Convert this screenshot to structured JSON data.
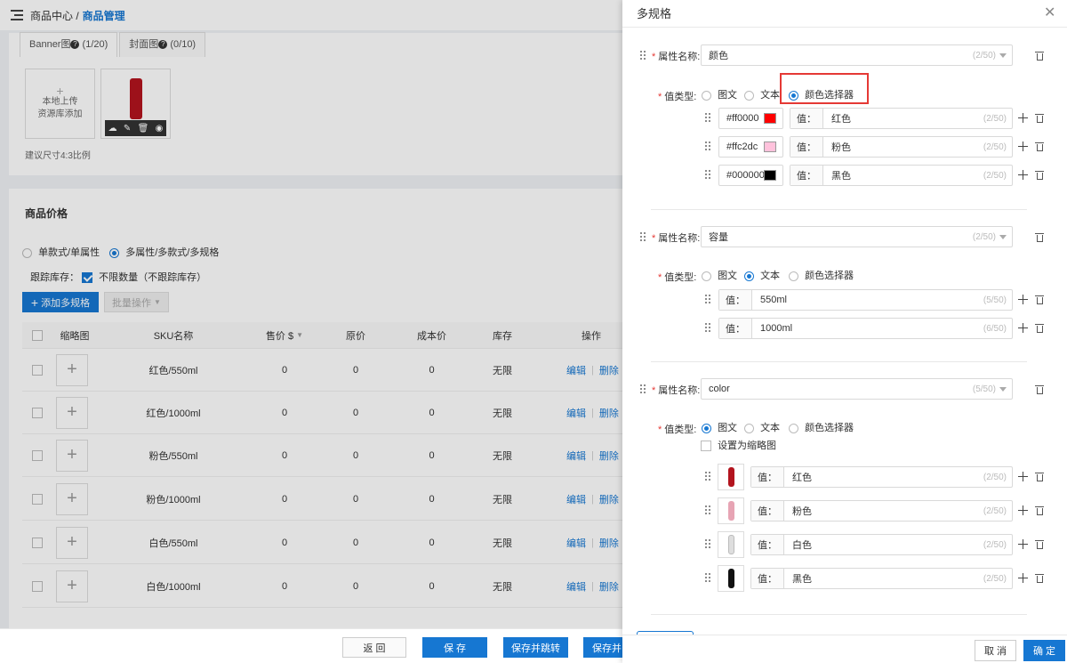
{
  "page": {
    "breadcrumb_root": "商品中心 /",
    "breadcrumb_current": "商品管理",
    "tabs": [
      {
        "label": "Banner图",
        "count": "(1/20)"
      },
      {
        "label": "封面图",
        "count": "(0/10)"
      }
    ],
    "upload_line1": "本地上传",
    "upload_line2": "资源库添加",
    "size_hint": "建议尺寸4:3比例",
    "price_section_title": "商品价格",
    "mode_single": "单款式/单属性",
    "mode_multi": "多属性/多款式/多规格",
    "stock_label": "跟踪库存：",
    "stock_unlimited": "不限数量（不跟踪库存）",
    "add_spec_button": "添加多规格",
    "batch_button": "批量操作",
    "table": {
      "headers": [
        "缩略图",
        "SKU名称",
        "售价 $",
        "原价",
        "成本价",
        "库存",
        "操作"
      ],
      "rows": [
        {
          "name": "红色/550ml",
          "price": "0",
          "orig": "0",
          "cost": "0",
          "stock": "无限"
        },
        {
          "name": "红色/1000ml",
          "price": "0",
          "orig": "0",
          "cost": "0",
          "stock": "无限"
        },
        {
          "name": "粉色/550ml",
          "price": "0",
          "orig": "0",
          "cost": "0",
          "stock": "无限"
        },
        {
          "name": "粉色/1000ml",
          "price": "0",
          "orig": "0",
          "cost": "0",
          "stock": "无限"
        },
        {
          "name": "白色/550ml",
          "price": "0",
          "orig": "0",
          "cost": "0",
          "stock": "无限"
        },
        {
          "name": "白色/1000ml",
          "price": "0",
          "orig": "0",
          "cost": "0",
          "stock": "无限"
        }
      ],
      "edit_label": "编辑",
      "delete_label": "删除",
      "sep": "|"
    },
    "footer_buttons": {
      "back": "返 回",
      "save": "保 存",
      "save_jump": "保存并跳转",
      "save_more": "保存并"
    }
  },
  "drawer": {
    "title": "多规格",
    "name_label": "属性名称:",
    "type_label": "值类型:",
    "type_options": [
      "图文",
      "文本",
      "颜色选择器"
    ],
    "value_prefix": "值：",
    "thumb_checkbox": "设置为缩略图",
    "groups": [
      {
        "name": "颜色",
        "name_count": "(2/50)",
        "type": "颜色选择器",
        "values": [
          {
            "hex": "#ff0000",
            "swatch": "#ff0000",
            "value": "红色",
            "count": "(2/50)"
          },
          {
            "hex": "#ffc2dc",
            "swatch": "#ffc2dc",
            "value": "粉色",
            "count": "(2/50)"
          },
          {
            "hex": "#000000",
            "swatch": "#000000",
            "value": "黑色",
            "count": "(2/50)"
          }
        ]
      },
      {
        "name": "容量",
        "name_count": "(2/50)",
        "type": "文本",
        "values": [
          {
            "value": "550ml",
            "count": "(5/50)"
          },
          {
            "value": "1000ml",
            "count": "(6/50)"
          }
        ]
      },
      {
        "name": "color",
        "name_count": "(5/50)",
        "type": "图文",
        "values": [
          {
            "value": "红色",
            "count": "(2/50)",
            "img": "#b3141e"
          },
          {
            "value": "粉色",
            "count": "(2/50)",
            "img": "#e7a4b4"
          },
          {
            "value": "白色",
            "count": "(2/50)",
            "img": "#dedede"
          },
          {
            "value": "黑色",
            "count": "(2/50)",
            "img": "#111111"
          }
        ]
      }
    ],
    "cancel": "取 消",
    "confirm": "确 定"
  }
}
